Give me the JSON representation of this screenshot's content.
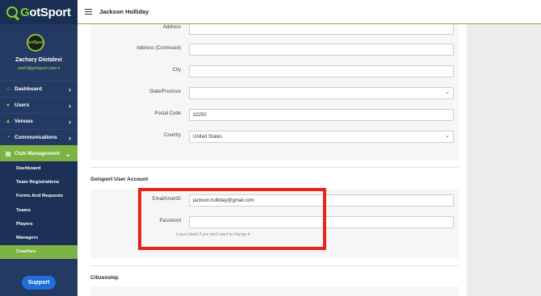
{
  "app": {
    "logo_text_g": "G",
    "logo_text_rest": "otSport",
    "logo_color": "#7ed321"
  },
  "user": {
    "name": "Zachary Diotalevi",
    "email": "zach@gotsport.com",
    "avatar_text": "GotSport"
  },
  "nav": {
    "items": [
      {
        "label": "Dashboard",
        "icon": "home-icon"
      },
      {
        "label": "Users",
        "icon": "users-icon"
      },
      {
        "label": "Venues",
        "icon": "venue-icon"
      },
      {
        "label": "Communications",
        "icon": "chat-icon"
      },
      {
        "label": "Club Management",
        "icon": "club-icon"
      }
    ],
    "sub_items": [
      "Dashboard",
      "Team Registrations",
      "Forms And Requests",
      "Teams",
      "Players",
      "Managers",
      "Coaches"
    ]
  },
  "support": {
    "label": "Support"
  },
  "header": {
    "title": "Jackson Holliday"
  },
  "address_form": {
    "address_label": "Address",
    "address_value": "",
    "address2_label": "Address (Continued)",
    "address2_value": "",
    "city_label": "City",
    "city_value": "",
    "state_label": "State/Province",
    "state_value": "",
    "postal_label": "Postal Code",
    "postal_value": "32250",
    "country_label": "Country",
    "country_value": "United States"
  },
  "account": {
    "section_title": "Gotsport User Account",
    "email_label": "Email/UserID",
    "email_value": "jackson.holliday@gmail.com",
    "password_label": "Password",
    "password_value": "",
    "password_hint": "Leave blank if you don't want to change it."
  },
  "citizenship": {
    "section_title": "Citizenship"
  },
  "colors": {
    "sidebar": "#233a63",
    "accent": "#7cb342",
    "support": "#1e6fd9",
    "highlight": "#e8231b"
  }
}
